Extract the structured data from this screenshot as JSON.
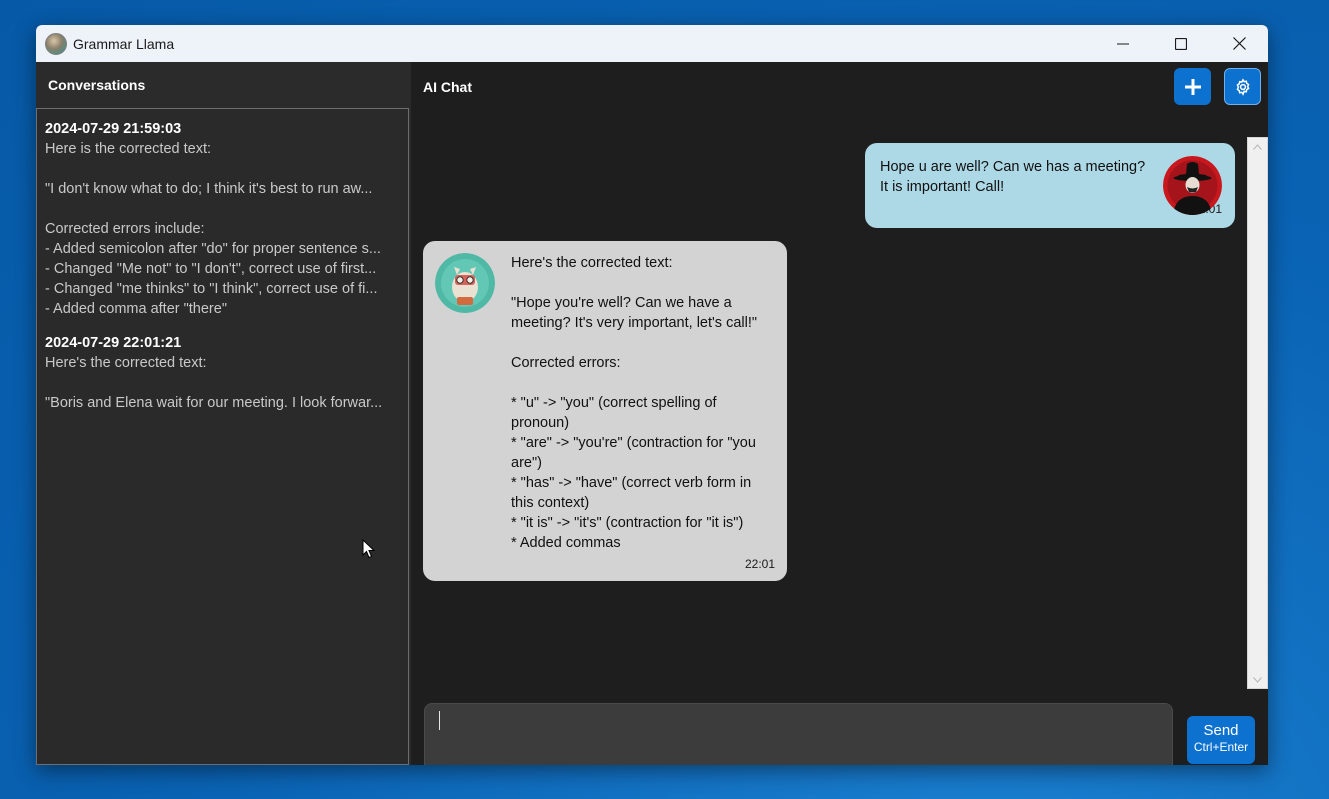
{
  "window": {
    "title": "Grammar Llama",
    "controls": [
      "minimize",
      "maximize",
      "close"
    ]
  },
  "sidebar": {
    "title": "Conversations",
    "conversations": [
      {
        "date": "2024-07-29 21:59:03",
        "lines": [
          "Here is the corrected text:",
          "",
          "\"I don't know what to do; I think it's best to run aw...",
          "",
          "Corrected errors include:",
          "- Added semicolon after \"do\" for proper sentence s...",
          "- Changed \"Me not\" to \"I don't\", correct use of first...",
          "- Changed \"me thinks\" to \"I think\", correct use of fi...",
          "- Added comma after \"there\""
        ]
      },
      {
        "date": "2024-07-29 22:01:21",
        "lines": [
          "Here's the corrected text:",
          "",
          "\"Boris and Elena wait for our meeting. I look forwar..."
        ]
      }
    ]
  },
  "main": {
    "title": "AI Chat",
    "new_chat_icon": "plus-icon",
    "settings_icon": "gear-icon",
    "messages": [
      {
        "role": "user",
        "text": "Hope u are well? Can we has a meeting?\nIt is important! Call!",
        "time": "22:01"
      },
      {
        "role": "assistant",
        "text": "Here's the corrected text:\n\n\"Hope you're well? Can we have a\nmeeting? It's very important, let's call!\"\n\nCorrected errors:\n\n* \"u\" -> \"you\" (correct spelling of\npronoun)\n* \"are\" -> \"you're\" (contraction for \"you\nare\")\n* \"has\" -> \"have\" (correct verb form in\nthis context)\n* \"it is\" -> \"it's\" (contraction for \"it is\")\n* Added commas",
        "time": "22:01"
      }
    ],
    "input": {
      "value": "",
      "send_label": "Send",
      "send_shortcut": "Ctrl+Enter"
    }
  },
  "colors": {
    "desktop": "#0a63b4",
    "accent": "#0d71cf",
    "user_bubble": "#add8e6",
    "ai_bubble": "#d3d3d3",
    "sidebar": "#2b2b2b",
    "chat_bg": "#1e1e1e"
  }
}
